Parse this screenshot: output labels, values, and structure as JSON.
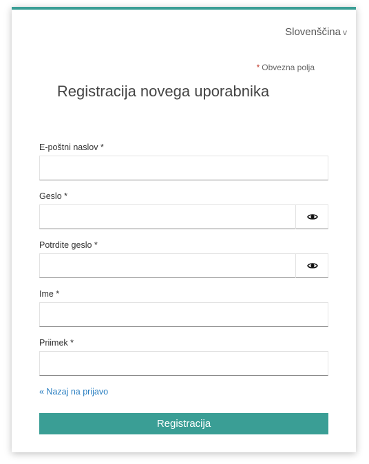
{
  "header": {
    "language": "Slovenščina",
    "language_chevron": "v"
  },
  "required_note": {
    "star": "*",
    "text": "Obvezna polja"
  },
  "title": "Registracija novega uporabnika",
  "fields": {
    "email": {
      "label": "E-poštni naslov *",
      "value": ""
    },
    "password": {
      "label": "Geslo *",
      "value": ""
    },
    "confirm_password": {
      "label": "Potrdite geslo *",
      "value": ""
    },
    "first_name": {
      "label": "Ime *",
      "value": ""
    },
    "last_name": {
      "label": "Priimek *",
      "value": ""
    }
  },
  "back_link": "« Nazaj na prijavo",
  "submit_label": "Registracija",
  "colors": {
    "accent": "#3a9e95",
    "link": "#2a7fc1",
    "required_star": "#c0392b"
  },
  "icons": {
    "password_toggle": "eye-icon",
    "language_dropdown": "chevron-down-icon"
  }
}
